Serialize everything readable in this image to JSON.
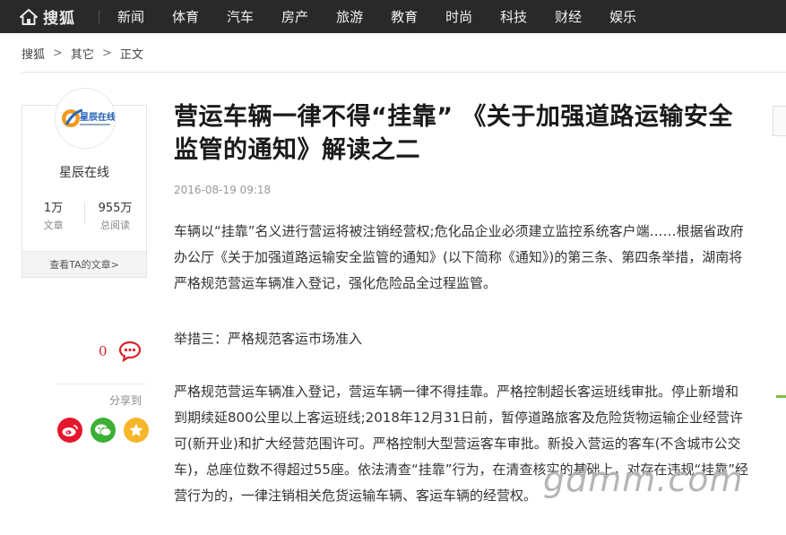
{
  "nav": {
    "logo_text": "搜狐",
    "items": [
      "新闻",
      "体育",
      "汽车",
      "房产",
      "旅游",
      "教育",
      "时尚",
      "科技",
      "财经",
      "娱乐"
    ]
  },
  "breadcrumb": [
    "搜狐",
    "其它",
    "正文"
  ],
  "breadcrumb_sep": ">",
  "author": {
    "name": "星辰在线",
    "logo_text": "星辰在线",
    "articles_count": "1万",
    "articles_label": "文章",
    "views_count": "955万",
    "views_label": "总阅读",
    "more_link": "查看TA的文章>"
  },
  "actions": {
    "comment_count": "0",
    "share_label": "分享到"
  },
  "article": {
    "title": "营运车辆一律不得“挂靠” 《关于加强道路运输安全监管的通知》解读之二",
    "time": "2016-08-19 09:18",
    "paragraphs": [
      "车辆以“挂靠”名义进行营运将被注销经营权;危化品企业必须建立监控系统客户端……根据省政府办公厅《关于加强道路运输安全监管的通知》(以下简称《通知》)的第三条、第四条举措，湖南将严格规范营运车辆准入登记，强化危险品全过程监管。",
      "举措三：严格规范客运市场准入",
      "严格规范营运车辆准入登记，营运车辆一律不得挂靠。严格控制超长客运班线审批。停止新增和到期续延800公里以上客运班线;2018年12月31日前，暂停道路旅客及危险货物运输企业经营许可(新开业)和扩大经营范围许可。严格控制大型营运客车审批。新投入营运的客车(不含城市公交车)，总座位数不得超过55座。依法清查“挂靠”行为，在清查核实的基础上，对存在违规“挂靠”经营行为的，一律注销相关危货运输车辆、客运车辆的经营权。"
    ]
  },
  "watermark": "gdmm.com",
  "colors": {
    "nav_bg": "#292929",
    "comment_red": "#d9232b",
    "weibo": "#e6162d",
    "wechat": "#3cb034",
    "qzone": "#f7b529"
  }
}
